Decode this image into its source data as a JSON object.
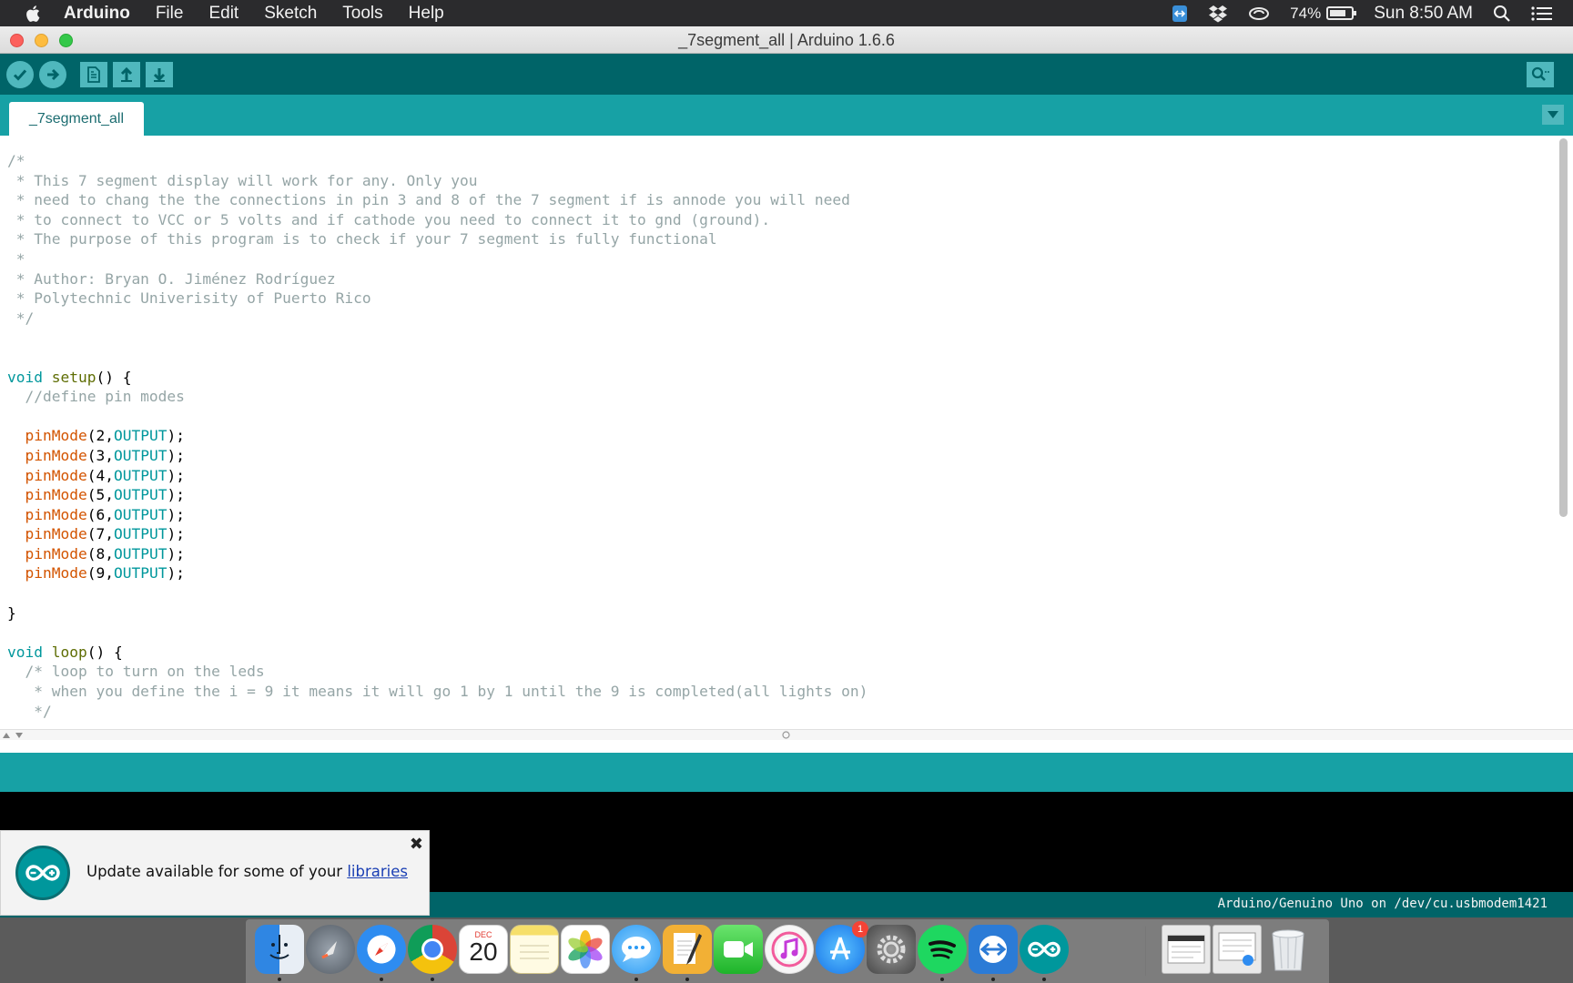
{
  "menubar": {
    "app": "Arduino",
    "items": [
      "File",
      "Edit",
      "Sketch",
      "Tools",
      "Help"
    ],
    "battery_pct": "74%",
    "clock": "Sun 8:50 AM"
  },
  "window": {
    "title": "_7segment_all | Arduino 1.6.6"
  },
  "tabs": [
    "_7segment_all"
  ],
  "code_lines": [
    "/*",
    " * This 7 segment display will work for any. Only you",
    " * need to chang the the connections in pin 3 and 8 of the 7 segment if is annode you will need",
    " * to connect to VCC or 5 volts and if cathode you need to connect it to gnd (ground).",
    " * The purpose of this program is to check if your 7 segment is fully functional",
    " *",
    " * Author: Bryan O. Jiménez Rodríguez",
    " * Polytechnic Univerisity of Puerto Rico",
    " */",
    "",
    "",
    "void setup() {",
    "  //define pin modes",
    "",
    "  pinMode(2,OUTPUT);",
    "  pinMode(3,OUTPUT);",
    "  pinMode(4,OUTPUT);",
    "  pinMode(5,OUTPUT);",
    "  pinMode(6,OUTPUT);",
    "  pinMode(7,OUTPUT);",
    "  pinMode(8,OUTPUT);",
    "  pinMode(9,OUTPUT);",
    "",
    "}",
    "",
    "void loop() {",
    "  /* loop to turn on the leds",
    "   * when you define the i = 9 it means it will go 1 by 1 until the 9 is completed(all lights on)",
    "   */"
  ],
  "notification": {
    "text": "Update available for some of your ",
    "link": "libraries",
    "close_glyph": "✖"
  },
  "status": {
    "board": "Arduino/Genuino Uno on /dev/cu.usbmodem1421"
  },
  "dock": {
    "calendar_month": "DEC",
    "calendar_day": "20",
    "appstore_badge": "1"
  },
  "colors": {
    "toolbar": "#006468",
    "tabbar": "#17a1a5",
    "button": "#4fb8bd"
  }
}
